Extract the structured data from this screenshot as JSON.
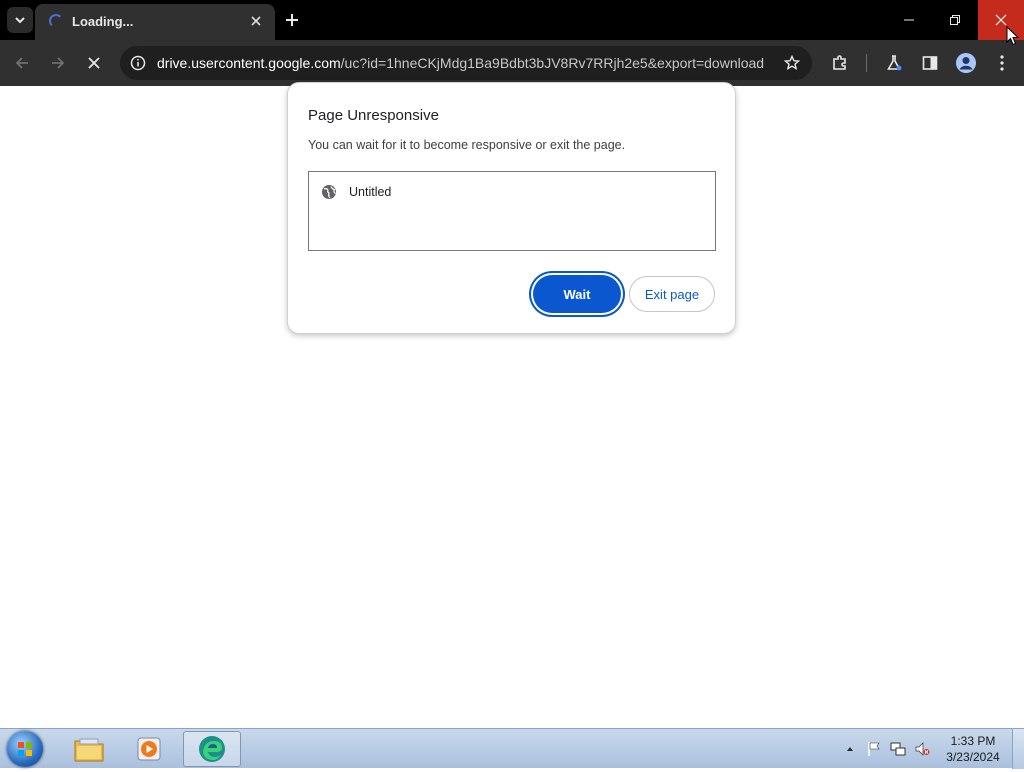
{
  "browser": {
    "tab": {
      "title": "Loading..."
    },
    "toolbar": {
      "url_host": "drive.usercontent.google.com",
      "url_path": "/uc?id=1hneCKjMdg1Ba9Bdbt3bJV8Rv7RRjh2e5&export=download"
    }
  },
  "dialog": {
    "title": "Page Unresponsive",
    "message": "You can wait for it to become responsive or exit the page.",
    "pages": [
      {
        "label": "Untitled",
        "icon": "globe-icon"
      }
    ],
    "wait_label": "Wait",
    "exit_label": "Exit page",
    "accent": "#0b57d0"
  },
  "taskbar": {
    "apps": [
      "file-explorer-icon",
      "media-player-icon",
      "edge-browser-icon"
    ],
    "clock_time": "1:33 PM",
    "clock_date": "3/23/2024"
  },
  "colors": {
    "close_hover": "#c42b1c",
    "toolbar": "#303030",
    "tabstrip": "#000000"
  }
}
